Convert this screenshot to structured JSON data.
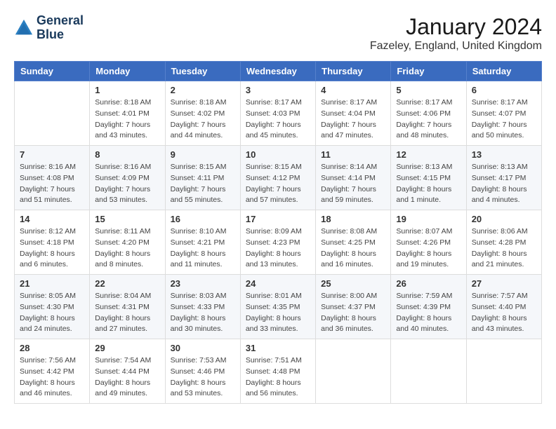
{
  "header": {
    "logo_line1": "General",
    "logo_line2": "Blue",
    "month": "January 2024",
    "location": "Fazeley, England, United Kingdom"
  },
  "weekdays": [
    "Sunday",
    "Monday",
    "Tuesday",
    "Wednesday",
    "Thursday",
    "Friday",
    "Saturday"
  ],
  "weeks": [
    [
      {
        "day": "",
        "sunrise": "",
        "sunset": "",
        "daylight": ""
      },
      {
        "day": "1",
        "sunrise": "Sunrise: 8:18 AM",
        "sunset": "Sunset: 4:01 PM",
        "daylight": "Daylight: 7 hours and 43 minutes."
      },
      {
        "day": "2",
        "sunrise": "Sunrise: 8:18 AM",
        "sunset": "Sunset: 4:02 PM",
        "daylight": "Daylight: 7 hours and 44 minutes."
      },
      {
        "day": "3",
        "sunrise": "Sunrise: 8:17 AM",
        "sunset": "Sunset: 4:03 PM",
        "daylight": "Daylight: 7 hours and 45 minutes."
      },
      {
        "day": "4",
        "sunrise": "Sunrise: 8:17 AM",
        "sunset": "Sunset: 4:04 PM",
        "daylight": "Daylight: 7 hours and 47 minutes."
      },
      {
        "day": "5",
        "sunrise": "Sunrise: 8:17 AM",
        "sunset": "Sunset: 4:06 PM",
        "daylight": "Daylight: 7 hours and 48 minutes."
      },
      {
        "day": "6",
        "sunrise": "Sunrise: 8:17 AM",
        "sunset": "Sunset: 4:07 PM",
        "daylight": "Daylight: 7 hours and 50 minutes."
      }
    ],
    [
      {
        "day": "7",
        "sunrise": "Sunrise: 8:16 AM",
        "sunset": "Sunset: 4:08 PM",
        "daylight": "Daylight: 7 hours and 51 minutes."
      },
      {
        "day": "8",
        "sunrise": "Sunrise: 8:16 AM",
        "sunset": "Sunset: 4:09 PM",
        "daylight": "Daylight: 7 hours and 53 minutes."
      },
      {
        "day": "9",
        "sunrise": "Sunrise: 8:15 AM",
        "sunset": "Sunset: 4:11 PM",
        "daylight": "Daylight: 7 hours and 55 minutes."
      },
      {
        "day": "10",
        "sunrise": "Sunrise: 8:15 AM",
        "sunset": "Sunset: 4:12 PM",
        "daylight": "Daylight: 7 hours and 57 minutes."
      },
      {
        "day": "11",
        "sunrise": "Sunrise: 8:14 AM",
        "sunset": "Sunset: 4:14 PM",
        "daylight": "Daylight: 7 hours and 59 minutes."
      },
      {
        "day": "12",
        "sunrise": "Sunrise: 8:13 AM",
        "sunset": "Sunset: 4:15 PM",
        "daylight": "Daylight: 8 hours and 1 minute."
      },
      {
        "day": "13",
        "sunrise": "Sunrise: 8:13 AM",
        "sunset": "Sunset: 4:17 PM",
        "daylight": "Daylight: 8 hours and 4 minutes."
      }
    ],
    [
      {
        "day": "14",
        "sunrise": "Sunrise: 8:12 AM",
        "sunset": "Sunset: 4:18 PM",
        "daylight": "Daylight: 8 hours and 6 minutes."
      },
      {
        "day": "15",
        "sunrise": "Sunrise: 8:11 AM",
        "sunset": "Sunset: 4:20 PM",
        "daylight": "Daylight: 8 hours and 8 minutes."
      },
      {
        "day": "16",
        "sunrise": "Sunrise: 8:10 AM",
        "sunset": "Sunset: 4:21 PM",
        "daylight": "Daylight: 8 hours and 11 minutes."
      },
      {
        "day": "17",
        "sunrise": "Sunrise: 8:09 AM",
        "sunset": "Sunset: 4:23 PM",
        "daylight": "Daylight: 8 hours and 13 minutes."
      },
      {
        "day": "18",
        "sunrise": "Sunrise: 8:08 AM",
        "sunset": "Sunset: 4:25 PM",
        "daylight": "Daylight: 8 hours and 16 minutes."
      },
      {
        "day": "19",
        "sunrise": "Sunrise: 8:07 AM",
        "sunset": "Sunset: 4:26 PM",
        "daylight": "Daylight: 8 hours and 19 minutes."
      },
      {
        "day": "20",
        "sunrise": "Sunrise: 8:06 AM",
        "sunset": "Sunset: 4:28 PM",
        "daylight": "Daylight: 8 hours and 21 minutes."
      }
    ],
    [
      {
        "day": "21",
        "sunrise": "Sunrise: 8:05 AM",
        "sunset": "Sunset: 4:30 PM",
        "daylight": "Daylight: 8 hours and 24 minutes."
      },
      {
        "day": "22",
        "sunrise": "Sunrise: 8:04 AM",
        "sunset": "Sunset: 4:31 PM",
        "daylight": "Daylight: 8 hours and 27 minutes."
      },
      {
        "day": "23",
        "sunrise": "Sunrise: 8:03 AM",
        "sunset": "Sunset: 4:33 PM",
        "daylight": "Daylight: 8 hours and 30 minutes."
      },
      {
        "day": "24",
        "sunrise": "Sunrise: 8:01 AM",
        "sunset": "Sunset: 4:35 PM",
        "daylight": "Daylight: 8 hours and 33 minutes."
      },
      {
        "day": "25",
        "sunrise": "Sunrise: 8:00 AM",
        "sunset": "Sunset: 4:37 PM",
        "daylight": "Daylight: 8 hours and 36 minutes."
      },
      {
        "day": "26",
        "sunrise": "Sunrise: 7:59 AM",
        "sunset": "Sunset: 4:39 PM",
        "daylight": "Daylight: 8 hours and 40 minutes."
      },
      {
        "day": "27",
        "sunrise": "Sunrise: 7:57 AM",
        "sunset": "Sunset: 4:40 PM",
        "daylight": "Daylight: 8 hours and 43 minutes."
      }
    ],
    [
      {
        "day": "28",
        "sunrise": "Sunrise: 7:56 AM",
        "sunset": "Sunset: 4:42 PM",
        "daylight": "Daylight: 8 hours and 46 minutes."
      },
      {
        "day": "29",
        "sunrise": "Sunrise: 7:54 AM",
        "sunset": "Sunset: 4:44 PM",
        "daylight": "Daylight: 8 hours and 49 minutes."
      },
      {
        "day": "30",
        "sunrise": "Sunrise: 7:53 AM",
        "sunset": "Sunset: 4:46 PM",
        "daylight": "Daylight: 8 hours and 53 minutes."
      },
      {
        "day": "31",
        "sunrise": "Sunrise: 7:51 AM",
        "sunset": "Sunset: 4:48 PM",
        "daylight": "Daylight: 8 hours and 56 minutes."
      },
      {
        "day": "",
        "sunrise": "",
        "sunset": "",
        "daylight": ""
      },
      {
        "day": "",
        "sunrise": "",
        "sunset": "",
        "daylight": ""
      },
      {
        "day": "",
        "sunrise": "",
        "sunset": "",
        "daylight": ""
      }
    ]
  ]
}
